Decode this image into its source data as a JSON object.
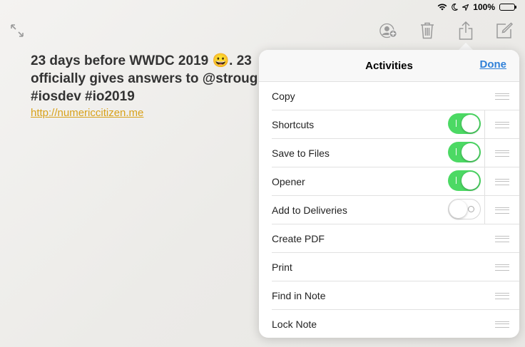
{
  "status": {
    "battery": "100%"
  },
  "note": {
    "text": "23 days before WWDC 2019 😀. 23\nofficially gives answers to @stroug\n#iosdev #io2019",
    "link": "http://numericcitizen.me"
  },
  "popover": {
    "title": "Activities",
    "done_label": "Done",
    "items": [
      {
        "label": "Copy",
        "toggle": null
      },
      {
        "label": "Shortcuts",
        "toggle": "on"
      },
      {
        "label": "Save to Files",
        "toggle": "on"
      },
      {
        "label": "Opener",
        "toggle": "on"
      },
      {
        "label": "Add to Deliveries",
        "toggle": "off"
      },
      {
        "label": "Create PDF",
        "toggle": null
      },
      {
        "label": "Print",
        "toggle": null
      },
      {
        "label": "Find in Note",
        "toggle": null
      },
      {
        "label": "Lock Note",
        "toggle": null
      }
    ]
  },
  "toolbar": {
    "icons": [
      "collaborate-icon",
      "trash-icon",
      "share-icon",
      "compose-icon"
    ]
  },
  "colors": {
    "accent": "#2f80d8",
    "toggle_on": "#4cd964",
    "link": "#d8a11a"
  }
}
